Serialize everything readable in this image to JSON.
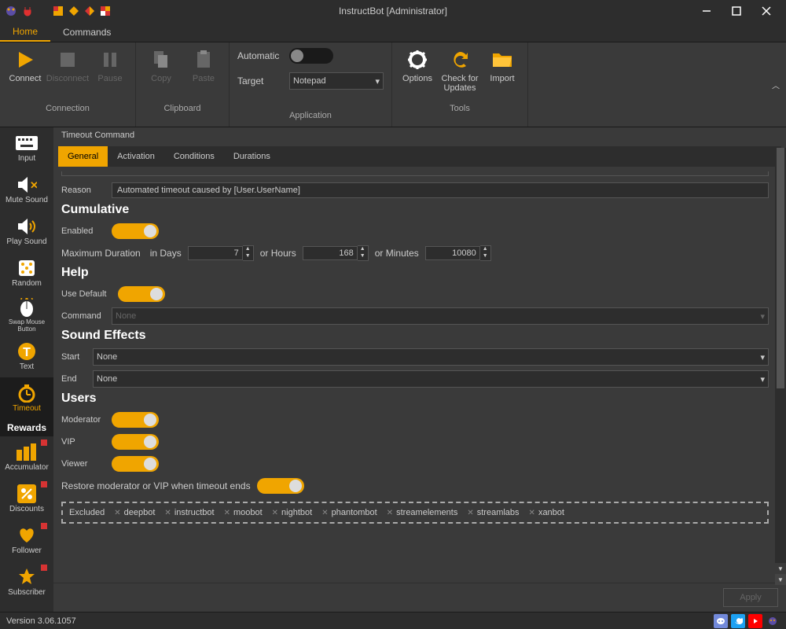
{
  "window": {
    "title": "InstructBot [Administrator]"
  },
  "tabs": {
    "home": "Home",
    "commands": "Commands"
  },
  "ribbon": {
    "connect": "Connect",
    "disconnect": "Disconnect",
    "pause": "Pause",
    "copy": "Copy",
    "paste": "Paste",
    "automatic_label": "Automatic",
    "target_label": "Target",
    "target_value": "Notepad",
    "options": "Options",
    "check_updates": "Check for Updates",
    "import": "Import",
    "group_connection": "Connection",
    "group_clipboard": "Clipboard",
    "group_application": "Application",
    "group_tools": "Tools"
  },
  "sidebar": {
    "input": "Input",
    "mute_sound": "Mute Sound",
    "play_sound": "Play Sound",
    "random": "Random",
    "swap_mouse": "Swap Mouse Button",
    "text": "Text",
    "timeout": "Timeout",
    "rewards": "Rewards",
    "accumulator": "Accumulator",
    "discounts": "Discounts",
    "follower": "Follower",
    "subscriber": "Subscriber"
  },
  "breadcrumb": "Timeout Command",
  "subtabs": {
    "general": "General",
    "activation": "Activation",
    "conditions": "Conditions",
    "durations": "Durations"
  },
  "form": {
    "reason_label": "Reason",
    "reason_value": "Automated timeout caused by [User.UserName]",
    "cumulative_header": "Cumulative",
    "enabled_label": "Enabled",
    "max_duration_label": "Maximum Duration",
    "in_days": "in Days",
    "days_value": "7",
    "or_hours": "or Hours",
    "hours_value": "168",
    "or_minutes": "or Minutes",
    "minutes_value": "10080",
    "help_header": "Help",
    "use_default_label": "Use Default",
    "command_label": "Command",
    "command_value": "None",
    "sound_header": "Sound Effects",
    "start_label": "Start",
    "start_value": "None",
    "end_label": "End",
    "end_value": "None",
    "users_header": "Users",
    "moderator_label": "Moderator",
    "vip_label": "VIP",
    "viewer_label": "Viewer",
    "restore_label": "Restore moderator or VIP when timeout ends",
    "excluded_label": "Excluded",
    "excluded_tags": [
      "deepbot",
      "instructbot",
      "moobot",
      "nightbot",
      "phantombot",
      "streamelements",
      "streamlabs",
      "xanbot"
    ]
  },
  "apply_label": "Apply",
  "status": {
    "version": "Version 3.06.1057"
  }
}
